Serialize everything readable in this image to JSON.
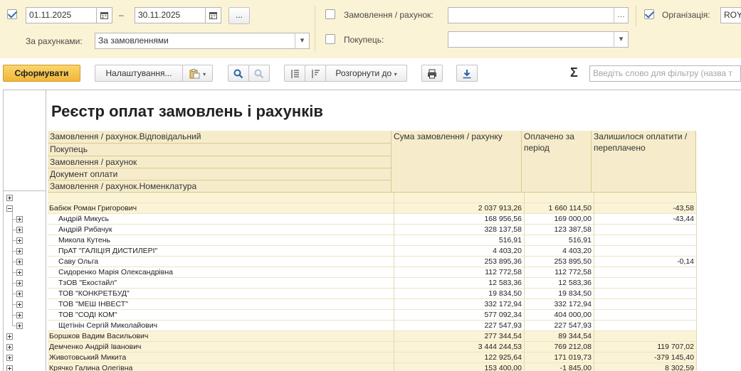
{
  "filters": {
    "period_enabled": true,
    "date_from": "01.11.2025",
    "date_to": "30.11.2025",
    "dash": "–",
    "period_button": "...",
    "by_accounts_label": "За рахунками:",
    "by_accounts_value": "За замовленнями",
    "order_enabled": false,
    "order_label": "Замовлення / рахунок:",
    "order_value": "",
    "buyer_enabled": false,
    "buyer_label": "Покупець:",
    "buyer_value": "",
    "org_enabled": true,
    "org_label": "Організація:",
    "org_value": "ROY"
  },
  "toolbar": {
    "generate_label": "Сформувати",
    "settings_label": "Налаштування...",
    "expand_label": "Розгорнути до",
    "search_placeholder": "Введіть слово для фільтру (назва т",
    "sum_icon": "Σ"
  },
  "report": {
    "title": "Реєстр оплат замовлень і рахунків",
    "group_headers": [
      "Замовлення / рахунок.Відповідальний",
      "Покупець",
      "Замовлення / рахунок",
      "Документ оплати",
      "Замовлення / рахунок.Номенклатура"
    ],
    "col_sum": "Сума замовлення / рахунку",
    "col_paid": "Оплачено за період",
    "col_left": "Залишилося оплатити / переплачено",
    "rows": [
      {
        "name": "",
        "sum": "",
        "paid": "",
        "left": "",
        "level": 0,
        "expanded": false,
        "top": true
      },
      {
        "name": "Бабюк Роман Григорович",
        "sum": "2 037 913,26",
        "paid": "1 660 114,50",
        "left": "-43,58",
        "level": 0,
        "expanded": true
      },
      {
        "name": "Андрій Микусь",
        "sum": "168 956,56",
        "paid": "169 000,00",
        "left": "-43,44",
        "level": 1
      },
      {
        "name": "Андрій Рибачук",
        "sum": "328 137,58",
        "paid": "123 387,58",
        "left": "",
        "level": 1
      },
      {
        "name": "Микола Кутень",
        "sum": "516,91",
        "paid": "516,91",
        "left": "",
        "level": 1
      },
      {
        "name": "ПрАТ \"ГАЛІЦІЯ ДИСТИЛЕРІ\"",
        "sum": "4 403,20",
        "paid": "4 403,20",
        "left": "",
        "level": 1
      },
      {
        "name": "Саву Ольга",
        "sum": "253 895,36",
        "paid": "253 895,50",
        "left": "-0,14",
        "level": 1
      },
      {
        "name": "Сидоренко Марія Олександрівна",
        "sum": "112 772,58",
        "paid": "112 772,58",
        "left": "",
        "level": 1
      },
      {
        "name": "ТзОВ \"Екостайл\"",
        "sum": "12 583,36",
        "paid": "12 583,36",
        "left": "",
        "level": 1
      },
      {
        "name": "ТОВ \"КОНКРЕТБУД\"",
        "sum": "19 834,50",
        "paid": "19 834,50",
        "left": "",
        "level": 1
      },
      {
        "name": "ТОВ \"МЕШ ІНВЕСТ\"",
        "sum": "332 172,94",
        "paid": "332 172,94",
        "left": "",
        "level": 1
      },
      {
        "name": "ТОВ \"СОДІ КОМ\"",
        "sum": "577 092,34",
        "paid": "404 000,00",
        "left": "",
        "level": 1
      },
      {
        "name": "Щетінін Сергій Миколайович",
        "sum": "227 547,93",
        "paid": "227 547,93",
        "left": "",
        "level": 1
      },
      {
        "name": "Боршков Вадим Васильович",
        "sum": "277 344,54",
        "paid": "89 344,54",
        "left": "",
        "level": 0,
        "expanded": false
      },
      {
        "name": "Демченко Андрій Іванович",
        "sum": "3 444 244,53",
        "paid": "769 212,08",
        "left": "119 707,02",
        "level": 0,
        "expanded": false
      },
      {
        "name": "Животовський Микита",
        "sum": "122 925,64",
        "paid": "171 019,73",
        "left": "-379 145,40",
        "level": 0,
        "expanded": false
      },
      {
        "name": "Крячко Галина Олегівна",
        "sum": "153 400,00",
        "paid": "-1 845,00",
        "left": "8 302,59",
        "level": 0,
        "expanded": false
      }
    ]
  }
}
